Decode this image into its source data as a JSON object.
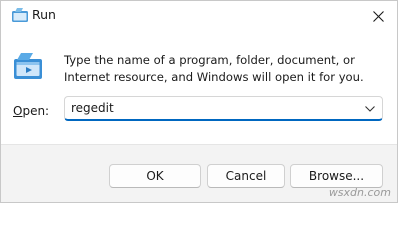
{
  "window": {
    "title": "Run",
    "close_icon": "close-icon",
    "app_icon": "run-app-icon"
  },
  "content": {
    "description": "Type the name of a program, folder, document, or Internet resource, and Windows will open it for you.",
    "open_label_prefix": "O",
    "open_label_rest": "pen:",
    "open_input_value": "regedit",
    "dropdown_icon": "chevron-down-icon"
  },
  "buttons": {
    "ok": "OK",
    "cancel": "Cancel",
    "browse": "Browse..."
  },
  "watermark": "wsxdn.com",
  "colors": {
    "accent": "#0067c0",
    "footer_bg": "#f3f3f3"
  }
}
